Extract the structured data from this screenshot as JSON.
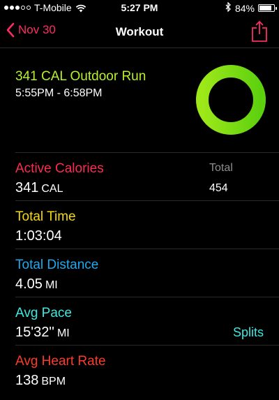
{
  "status_bar": {
    "carrier": "T-Mobile",
    "signal_bars_filled": 3,
    "signal_bars_total": 5,
    "time": "5:27 PM",
    "battery_percent_label": "84%",
    "battery_level": 0.84
  },
  "nav": {
    "back_label": "Nov 30",
    "title": "Workout"
  },
  "summary": {
    "title": "341 CAL Outdoor Run",
    "time_range": "5:55PM - 6:58PM",
    "ring_progress": 1.0,
    "ring_color": "#9be11a"
  },
  "metrics": {
    "active_calories": {
      "label": "Active Calories",
      "value": "341",
      "unit": "CAL",
      "color": "#fb2c4f"
    },
    "total": {
      "label": "Total",
      "value": "454"
    },
    "total_time": {
      "label": "Total Time",
      "value": "1:03:04",
      "color": "#f5d90a"
    },
    "total_distance": {
      "label": "Total Distance",
      "value": "4.05",
      "unit": "MI",
      "color": "#1fa9f0"
    },
    "avg_pace": {
      "label": "Avg Pace",
      "value": "15'32''",
      "unit": "MI",
      "color": "#3ee8e0"
    },
    "splits_label": "Splits",
    "avg_heart_rate": {
      "label": "Avg Heart Rate",
      "value": "138",
      "unit": "BPM",
      "color": "#fb3b2c"
    }
  }
}
